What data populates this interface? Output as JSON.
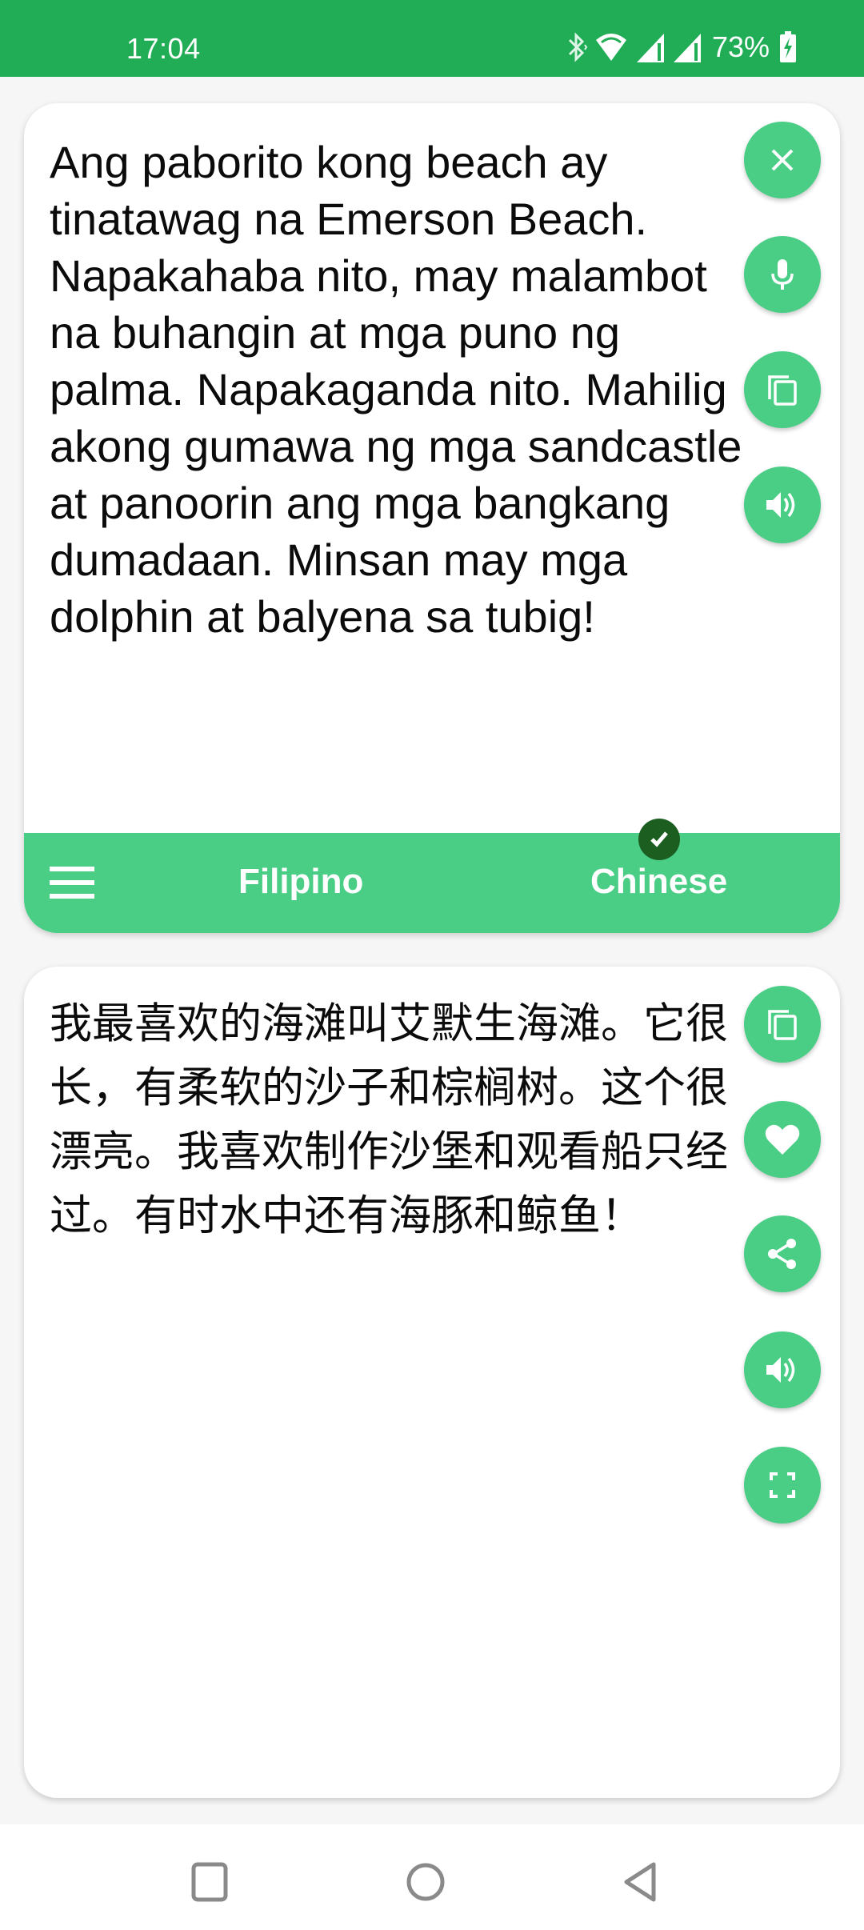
{
  "status_bar": {
    "time": "17:04",
    "battery_percent": "73%",
    "icons": [
      "bluetooth-icon",
      "wifi-icon",
      "signal-icon",
      "signal-icon",
      "battery-charging-icon"
    ]
  },
  "source_card": {
    "text": "Ang paborito kong beach ay tinatawag na Emerson Beach. Napakahaba nito, may malambot na buhangin at mga puno ng palma. Napakaganda nito. Mahilig akong gumawa ng mga sandcastle at panoorin ang mga bangkang dumadaan. Minsan may mga dolphin at balyena sa tubig!",
    "buttons": [
      {
        "name": "clear-button",
        "icon": "close-icon"
      },
      {
        "name": "mic-button",
        "icon": "microphone-icon"
      },
      {
        "name": "copy-button",
        "icon": "copy-icon"
      },
      {
        "name": "speak-button",
        "icon": "speaker-icon"
      }
    ]
  },
  "language_bar": {
    "menu_icon": "menu-icon",
    "source_language": "Filipino",
    "target_language": "Chinese",
    "selected": "Chinese"
  },
  "translation_card": {
    "text": "我最喜欢的海滩叫艾默生海滩。它很长，有柔软的沙子和棕榈树。这个很漂亮。我喜欢制作沙堡和观看船只经过。有时水中还有海豚和鲸鱼！",
    "buttons": [
      {
        "name": "copy-button",
        "icon": "copy-icon"
      },
      {
        "name": "favorite-button",
        "icon": "heart-icon"
      },
      {
        "name": "share-button",
        "icon": "share-icon"
      },
      {
        "name": "speak-button",
        "icon": "speaker-icon"
      },
      {
        "name": "fullscreen-button",
        "icon": "fullscreen-icon"
      }
    ]
  },
  "nav_bar": {
    "buttons": [
      "recents-icon",
      "home-icon",
      "back-icon"
    ]
  },
  "colors": {
    "status_bar": "#20ad56",
    "accent": "#4ace85",
    "check_badge": "#1b5e20",
    "background": "#f6f6f6"
  }
}
